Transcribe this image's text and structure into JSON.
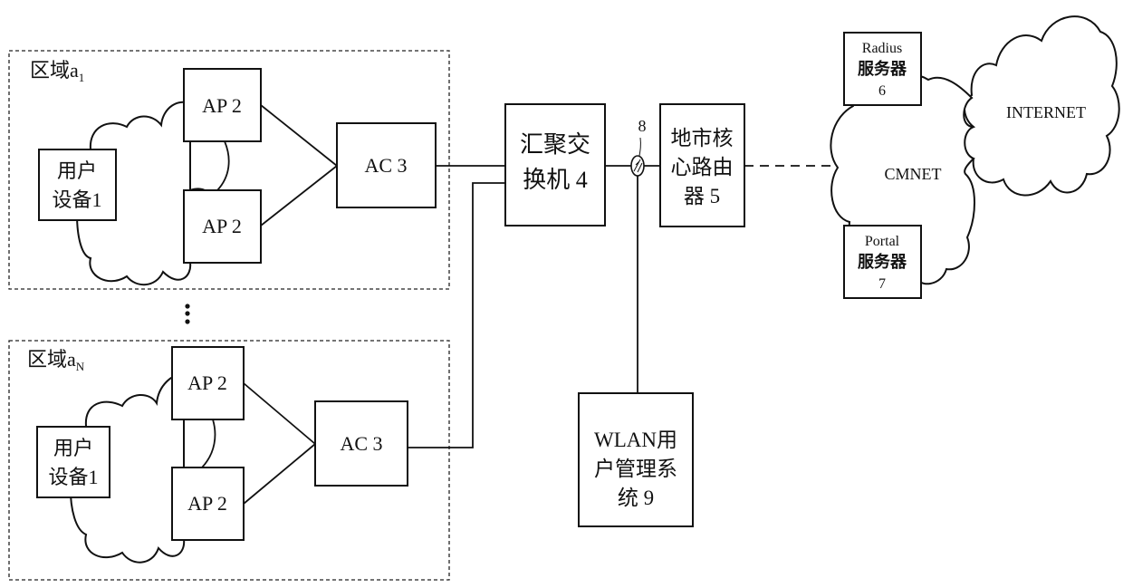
{
  "zones": [
    {
      "label_main": "区域a",
      "label_sub": "1",
      "user_device": [
        "用户",
        "设备1"
      ],
      "ap_top": "AP 2",
      "ap_bottom": "AP 2",
      "ac": "AC 3"
    },
    {
      "label_main": "区域a",
      "label_sub": "N",
      "user_device": [
        "用户",
        "设备1"
      ],
      "ap_top": "AP 2",
      "ap_bottom": "AP 2",
      "ac": "AC 3"
    }
  ],
  "ellipsis": "⋮",
  "aggregation_switch": [
    "汇聚交",
    "换机 4"
  ],
  "splitter_label": "8",
  "core_router": [
    "地市核",
    "心路由",
    "器 5"
  ],
  "wlan_system": [
    "WLAN用",
    "户管理系",
    "统 9"
  ],
  "radius_server": [
    "Radius",
    "服务器",
    "6"
  ],
  "portal_server": [
    "Portal",
    "服务器",
    "7"
  ],
  "cmnet_label": "CMNET",
  "internet_label": "INTERNET"
}
